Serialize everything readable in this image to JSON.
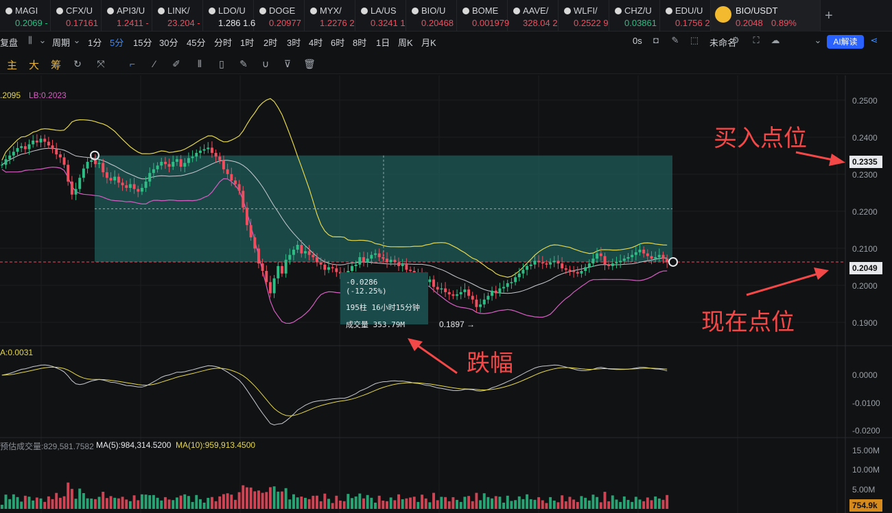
{
  "tabs": [
    {
      "sym": "MAGI",
      "price": "0.2069 -",
      "dir": "up"
    },
    {
      "sym": "CFX/U",
      "price": "0.17161",
      "dir": "down"
    },
    {
      "sym": "API3/U",
      "price": "1.2411 -",
      "dir": "down"
    },
    {
      "sym": "LINK/",
      "price": "23.204 -",
      "dir": "down"
    },
    {
      "sym": "LDO/U",
      "price": "1.286 1.6",
      "dir": "neutral"
    },
    {
      "sym": "DOGE",
      "price": "0.20977",
      "dir": "down"
    },
    {
      "sym": "MYX/",
      "price": "1.2276 2",
      "dir": "down"
    },
    {
      "sym": "LA/US",
      "price": "0.3241 1",
      "dir": "down"
    },
    {
      "sym": "BIO/U",
      "price": "0.20468",
      "dir": "down"
    },
    {
      "sym": "BOME",
      "price": "0.001979",
      "dir": "down"
    },
    {
      "sym": "AAVE/",
      "price": "328.04 2",
      "dir": "down"
    },
    {
      "sym": "WLFI/",
      "price": "0.2522 9",
      "dir": "down"
    },
    {
      "sym": "CHZ/U",
      "price": "0.03861",
      "dir": "up"
    },
    {
      "sym": "EDU/U",
      "price": "0.1756 2",
      "dir": "down"
    }
  ],
  "active_tab": {
    "sym": "BIO/USDT",
    "price": "0.2048",
    "change": "0.89%"
  },
  "add_tab_label": "+",
  "toolbar": {
    "replay": "复盘",
    "period": "周期",
    "intervals": [
      "1分",
      "5分",
      "15分",
      "30分",
      "45分",
      "分时",
      "1时",
      "2时",
      "3时",
      "4时",
      "6时",
      "8时",
      "1日",
      "周K",
      "月K"
    ],
    "active_interval": "5分",
    "countdown": "0s",
    "layout_name": "未命名",
    "ai_label": "AI解读"
  },
  "toolbar2": {
    "labels": [
      "主",
      "大",
      "筹"
    ]
  },
  "indicators": {
    "boll": ".2095",
    "lb": "LB:0.2023",
    "macd": "A:0.0031",
    "vol_label": "预估成交量:829,581.7582",
    "ma5": "MA(5):984,314.5200",
    "ma10": "MA(10):959,913.4500"
  },
  "price_axis": [
    "0.2500",
    "0.2400",
    "0.2300",
    "0.2200",
    "0.2100",
    "0.2000",
    "0.1900"
  ],
  "macd_axis": [
    "0.0000",
    "-0.0100",
    "-0.0200"
  ],
  "vol_axis": [
    "15.00M",
    "10.00M",
    "5.00M"
  ],
  "price_tags": {
    "buy": "0.2335",
    "current": "0.2049",
    "vol": "754.9k"
  },
  "tooltip": {
    "change": "-0.0286 (-12.25%)",
    "bars": "195柱 16小时15分钟",
    "volume": "成交量 353.79M"
  },
  "low_label": "0.1897 →",
  "annotations": {
    "buy": "买入点位",
    "now": "现在点位",
    "drop": "跌幅"
  },
  "colors": {
    "up": "#2fbd85",
    "down": "#ef4e5f",
    "accent": "#3d8bfd",
    "annot": "#f24848"
  },
  "chart_data": {
    "type": "candlestick",
    "price_range": [
      0.185,
      0.255
    ],
    "closes": [
      0.231,
      0.2325,
      0.2335,
      0.2345,
      0.2355,
      0.236,
      0.2352,
      0.2365,
      0.2375,
      0.237,
      0.238,
      0.2372,
      0.2362,
      0.2352,
      0.2338,
      0.233,
      0.231,
      0.2265,
      0.223,
      0.2245,
      0.2275,
      0.23,
      0.2318,
      0.2322,
      0.2312,
      0.2315,
      0.229,
      0.2275,
      0.2268,
      0.2278,
      0.2262,
      0.2255,
      0.2248,
      0.2258,
      0.2245,
      0.2238,
      0.2248,
      0.2265,
      0.2288,
      0.2298,
      0.2308,
      0.2318,
      0.2312,
      0.2305,
      0.2318,
      0.2325,
      0.2305,
      0.2315,
      0.2328,
      0.2332,
      0.2342,
      0.2348,
      0.2352,
      0.2356,
      0.2342,
      0.2332,
      0.2322,
      0.2298,
      0.2285,
      0.2268,
      0.2258,
      0.224,
      0.2195,
      0.2148,
      0.2115,
      0.2085,
      0.2045,
      0.2025,
      0.1995,
      0.1965,
      0.2005,
      0.2038,
      0.2018,
      0.2055,
      0.2068,
      0.2082,
      0.2095,
      0.2072,
      0.2078,
      0.2068,
      0.2062,
      0.2048,
      0.2042,
      0.2028,
      0.2035,
      0.2032,
      0.2022,
      0.2018,
      0.2008,
      0.2025,
      0.2038,
      0.2042,
      0.2062,
      0.2048,
      0.2058,
      0.2068,
      0.2072,
      0.2062,
      0.2058,
      0.2048,
      0.2055,
      0.2048,
      0.2038,
      0.2042,
      0.2028,
      0.2025,
      0.2012,
      0.2018,
      0.2005,
      0.1995,
      0.2002,
      0.1982,
      0.1975,
      0.1978,
      0.1968,
      0.1962,
      0.1958,
      0.1962,
      0.1968,
      0.1975,
      0.1958,
      0.1948,
      0.1928,
      0.1935,
      0.1948,
      0.1958,
      0.1972,
      0.1965,
      0.1978,
      0.1982,
      0.1992,
      0.1995,
      0.2008,
      0.2018,
      0.2028,
      0.2038,
      0.2042,
      0.2052,
      0.2048,
      0.2045,
      0.2042,
      0.2048,
      0.2052,
      0.2045,
      0.2032,
      0.2028,
      0.2025,
      0.2022,
      0.2018,
      0.2025,
      0.2035,
      0.2045,
      0.2058,
      0.2072,
      0.2065,
      0.2042,
      0.2038,
      0.2045,
      0.2048,
      0.2052,
      0.2058,
      0.2062,
      0.2068,
      0.2075,
      0.2082,
      0.2072,
      0.2065,
      0.2058,
      0.2062,
      0.2068,
      0.2058,
      0.2048
    ]
  }
}
